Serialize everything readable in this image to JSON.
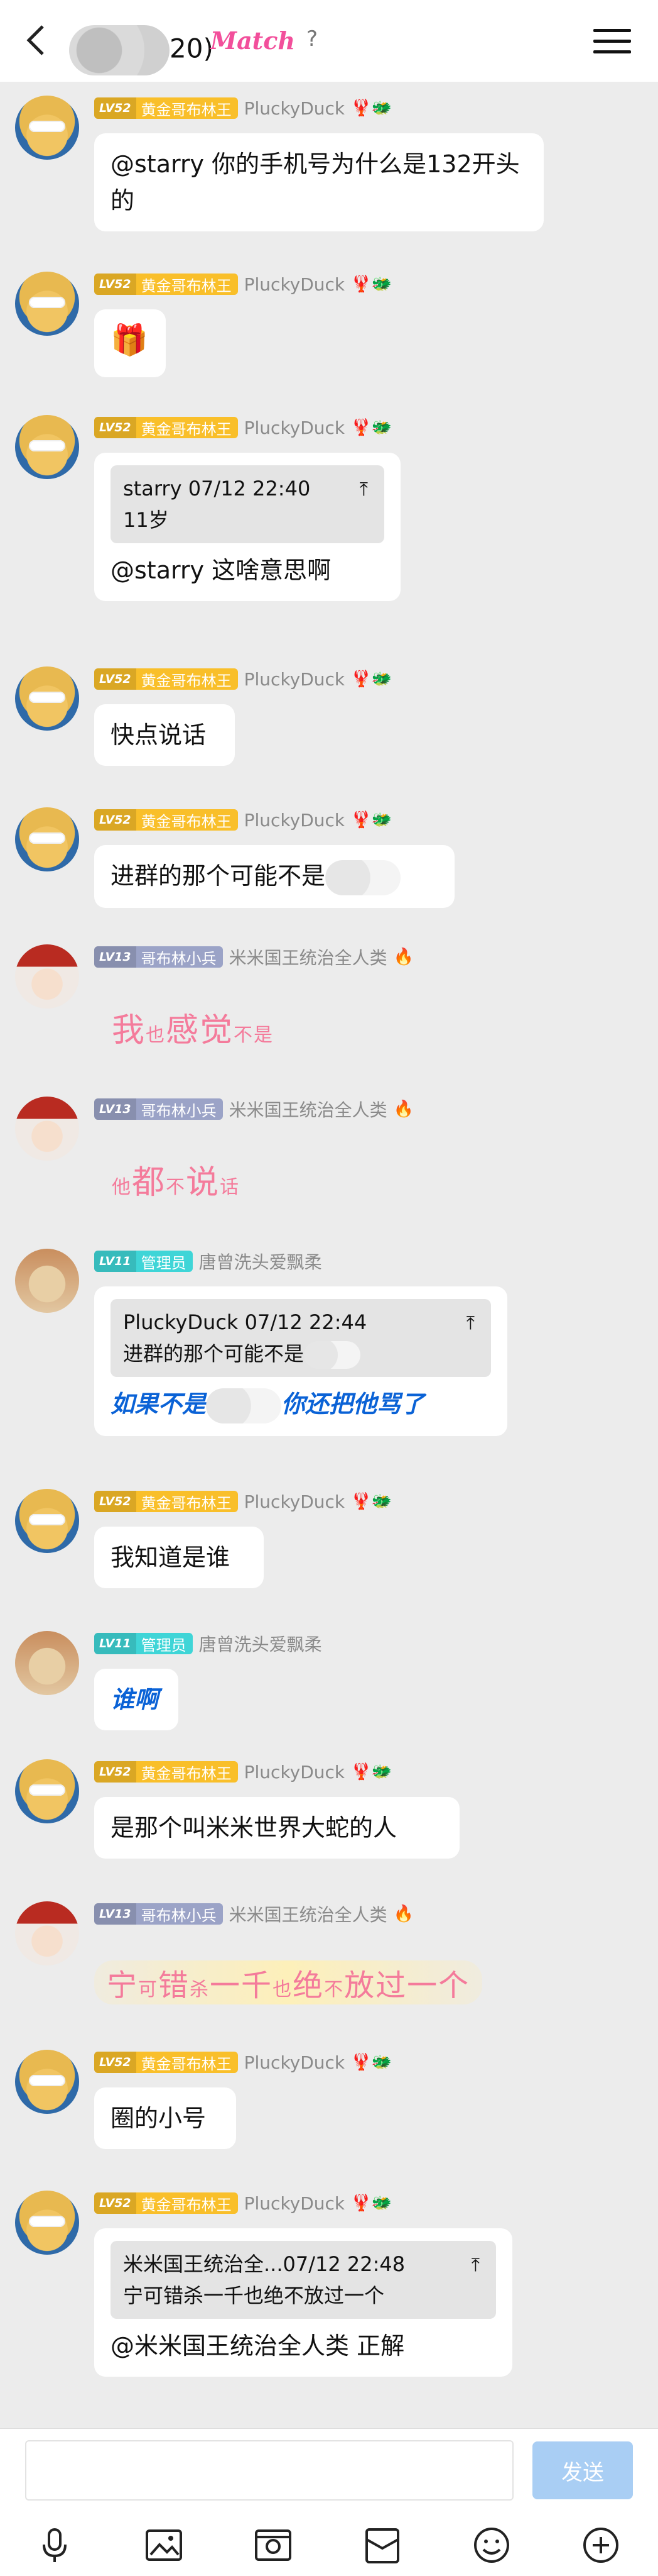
{
  "header": {
    "title_suffix": "20)",
    "match_label": "Match",
    "help_label": "?"
  },
  "messages": [
    {
      "level": "LV52",
      "title": "黄金哥布林王",
      "nick": "PluckyDuck",
      "text": "@starry 你的手机号为什么是132开头的"
    },
    {
      "level": "LV52",
      "title": "黄金哥布林王",
      "nick": "PluckyDuck",
      "emoji": "🎁"
    },
    {
      "level": "LV52",
      "title": "黄金哥布林王",
      "nick": "PluckyDuck",
      "quote_head": "starry 07/12 22:40",
      "quote_body": "11岁",
      "text": "@starry 这啥意思啊"
    },
    {
      "level": "LV52",
      "title": "黄金哥布林王",
      "nick": "PluckyDuck",
      "text": "快点说话"
    },
    {
      "level": "LV52",
      "title": "黄金哥布林王",
      "nick": "PluckyDuck",
      "text": "进群的那个可能不是"
    },
    {
      "level": "LV13",
      "title": "哥布林小兵",
      "nick": "米米国王统治全人类",
      "fancy": [
        "我",
        "也",
        "感",
        "觉",
        "不",
        "是"
      ]
    },
    {
      "level": "LV13",
      "title": "哥布林小兵",
      "nick": "米米国王统治全人类",
      "fancy": [
        "他",
        "都",
        "不",
        "说",
        "话"
      ]
    },
    {
      "level": "LV11",
      "title": "管理员",
      "nick": "唐曾洗头爱飘柔",
      "quote_head": "PluckyDuck 07/12 22:44",
      "quote_body": "进群的那个可能不是",
      "text_a": "如果不是",
      "text_b": "你还把他骂了"
    },
    {
      "level": "LV52",
      "title": "黄金哥布林王",
      "nick": "PluckyDuck",
      "text": "我知道是谁"
    },
    {
      "level": "LV11",
      "title": "管理员",
      "nick": "唐曾洗头爱飘柔",
      "text": "谁啊"
    },
    {
      "level": "LV52",
      "title": "黄金哥布林王",
      "nick": "PluckyDuck",
      "text": "是那个叫米米世界大蛇的人"
    },
    {
      "level": "LV13",
      "title": "哥布林小兵",
      "nick": "米米国王统治全人类",
      "fancy": [
        "宁",
        "可",
        "错",
        "杀",
        "一",
        "千",
        "也",
        "绝",
        "不",
        "放",
        "过",
        "一",
        "个"
      ]
    },
    {
      "level": "LV52",
      "title": "黄金哥布林王",
      "nick": "PluckyDuck",
      "text": "圈的小号"
    },
    {
      "level": "LV52",
      "title": "黄金哥布林王",
      "nick": "PluckyDuck",
      "quote_head": "米米国王统治全...07/12 22:48",
      "quote_body": "宁可错杀一千也绝不放过一个",
      "text": "@米米国王统治全人类 正解"
    }
  ],
  "composer": {
    "input_placeholder": "",
    "send_label": "发送"
  },
  "colors": {
    "gold_badge": "#f9bf2a",
    "gray_badge": "#9ba3c7",
    "cyan_badge": "#3fd5d7",
    "link_blue": "#0a62d6",
    "fancy_pink": "#f47b9b"
  }
}
